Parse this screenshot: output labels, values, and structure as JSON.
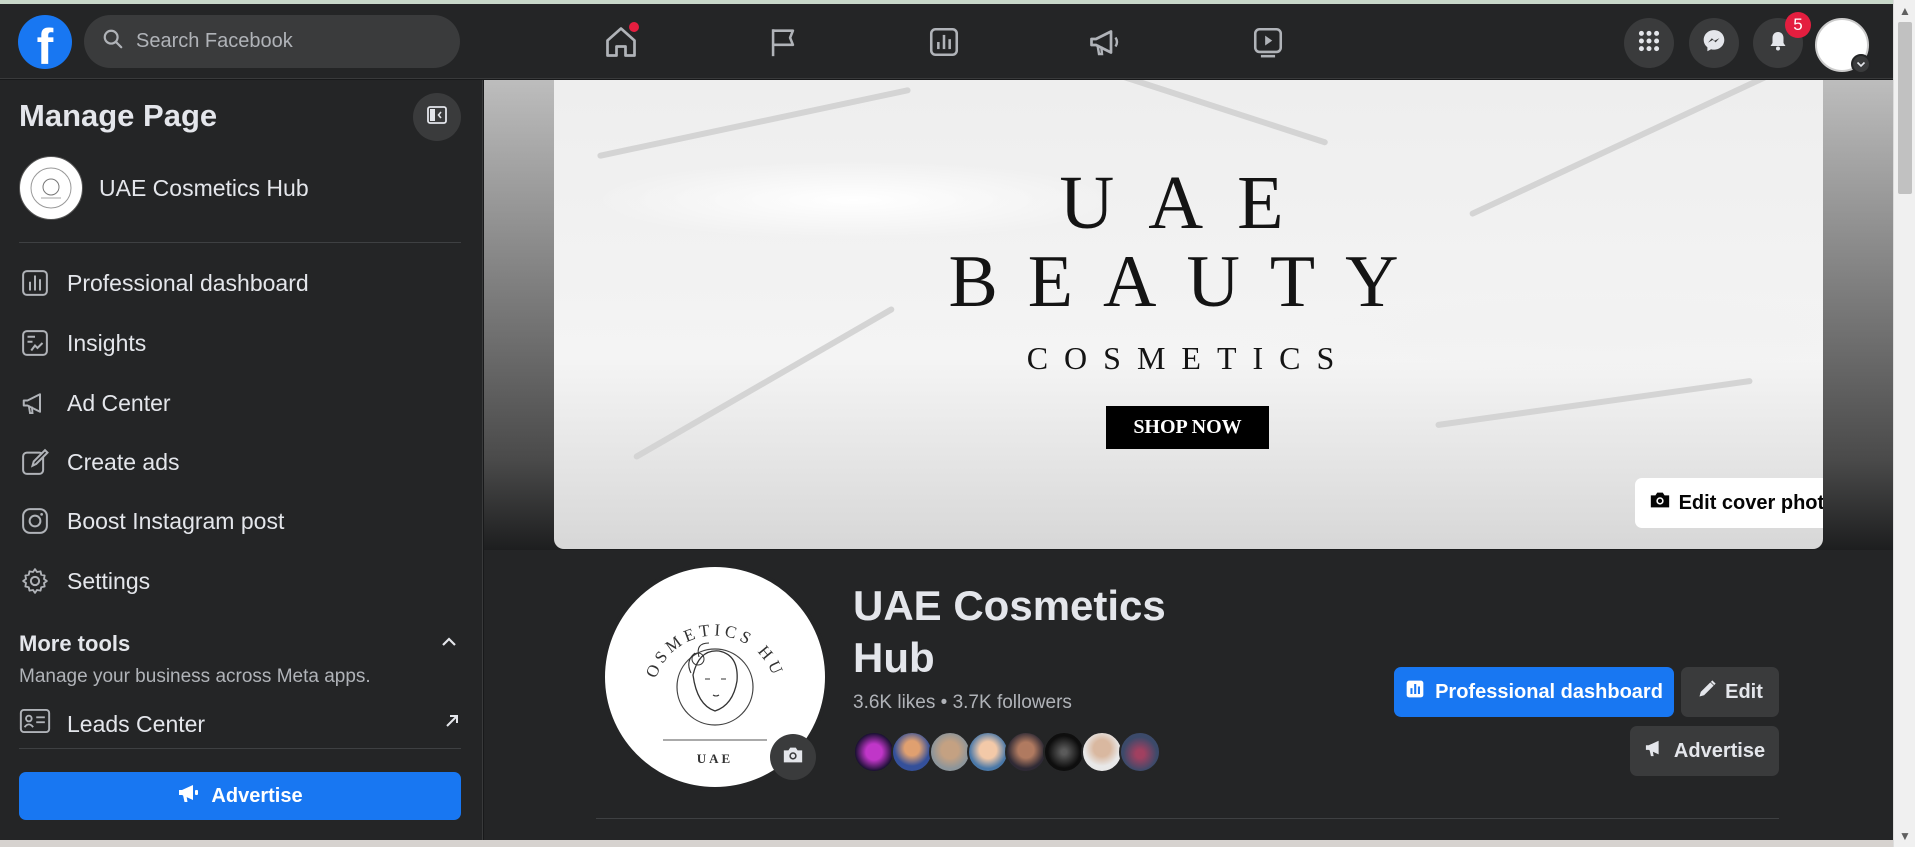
{
  "header": {
    "search_placeholder": "Search Facebook",
    "notification_count": "5"
  },
  "sidebar": {
    "title": "Manage Page",
    "page_name": "UAE Cosmetics Hub",
    "items": [
      {
        "label": "Professional dashboard",
        "icon": "dashboard-icon"
      },
      {
        "label": "Insights",
        "icon": "insights-icon"
      },
      {
        "label": "Ad Center",
        "icon": "megaphone-icon"
      },
      {
        "label": "Create ads",
        "icon": "edit-icon"
      },
      {
        "label": "Boost Instagram post",
        "icon": "instagram-icon"
      },
      {
        "label": "Settings",
        "icon": "gear-icon"
      }
    ],
    "more_tools_title": "More tools",
    "more_tools_subtitle": "Manage your business across Meta apps.",
    "leads_center": "Leads Center",
    "advertise_label": "Advertise"
  },
  "cover": {
    "line1": "UAE",
    "line2": "BEAUTY",
    "line3": "COSMETICS",
    "shop_button": "SHOP NOW",
    "edit_cover_label": "Edit cover photo"
  },
  "profile": {
    "name": "UAE Cosmetics Hub",
    "stats": "3.6K likes • 3.7K followers",
    "pic_text_top": "COSMETICS HUB",
    "pic_text_bottom": "UAE",
    "professional_dashboard_label": "Professional dashboard",
    "edit_label": "Edit",
    "advertise_label": "Advertise"
  },
  "colors": {
    "brand_blue": "#1877f2",
    "background": "#18191a",
    "surface": "#242526",
    "notification_red": "#e41e3f"
  }
}
